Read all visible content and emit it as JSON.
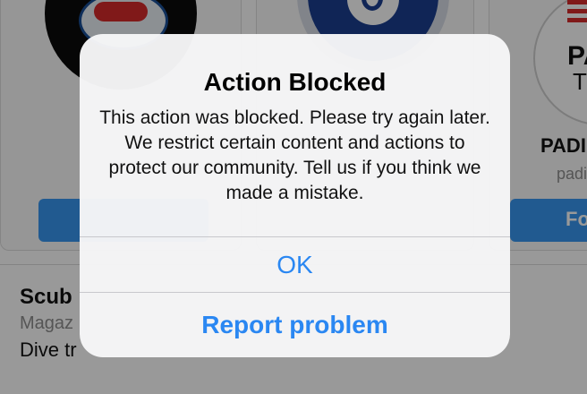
{
  "background": {
    "right_card": {
      "name_partial": "PADI",
      "handle_partial": "padi",
      "logo_text_top": "PAD",
      "logo_text_bottom": "Tr",
      "follow_partial": "Fo"
    },
    "bio": {
      "name_partial": "Scub",
      "category_partial": "Magaz",
      "text_partial": "Dive tr"
    }
  },
  "alert": {
    "title": "Action Blocked",
    "message": "This action was blocked. Please try again later. We restrict certain content and actions to protect our community. Tell us if you think we made a mistake.",
    "buttons": {
      "ok_label": "OK",
      "report_label": "Report problem"
    }
  },
  "colors": {
    "ios_blue": "#2a87f2",
    "follow_blue": "#3897f0",
    "dialog_bg": "#f6f6f7"
  }
}
